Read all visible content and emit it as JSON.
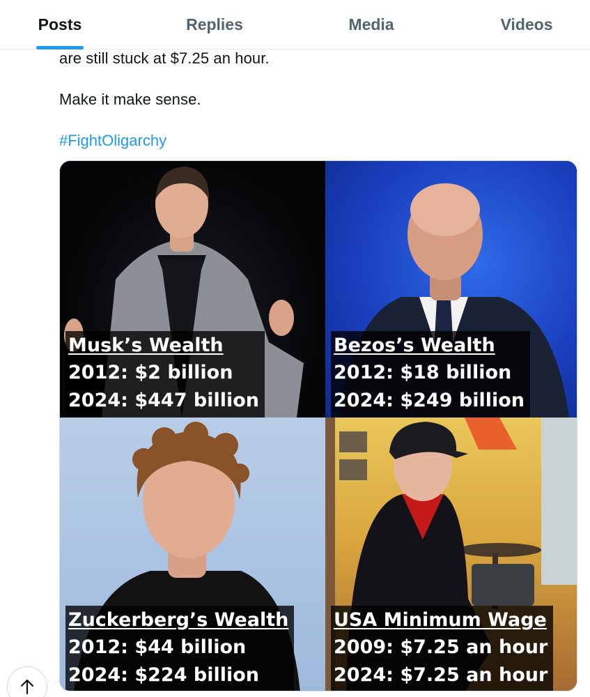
{
  "tabs": [
    {
      "label": "Posts",
      "active": true
    },
    {
      "label": "Replies",
      "active": false
    },
    {
      "label": "Media",
      "active": false
    },
    {
      "label": "Videos",
      "active": false
    }
  ],
  "post": {
    "line1": "are still stuck at $7.25 an hour.",
    "line2": "Make it make sense.",
    "hashtag": "#FightOligarchy"
  },
  "image": {
    "panels": [
      {
        "title": "Musk’s Wealth",
        "line1": "2012: $2 billion",
        "line2": "2024: $447 billion"
      },
      {
        "title": "Bezos’s Wealth",
        "line1": "2012: $18 billion",
        "line2": "2024: $249 billion"
      },
      {
        "title": "Zuckerberg’s Wealth",
        "line1": "2012: $44 billion",
        "line2": "2024: $224 billion"
      },
      {
        "title": "USA Minimum Wage",
        "line1": "2009: $7.25 an hour",
        "line2": "2024: $7.25 an hour"
      }
    ]
  },
  "colors": {
    "accent": "#1d9bf0",
    "text": "#0f1419",
    "muted": "#536471"
  },
  "icons": {
    "scroll_top": "arrow-up-icon"
  }
}
